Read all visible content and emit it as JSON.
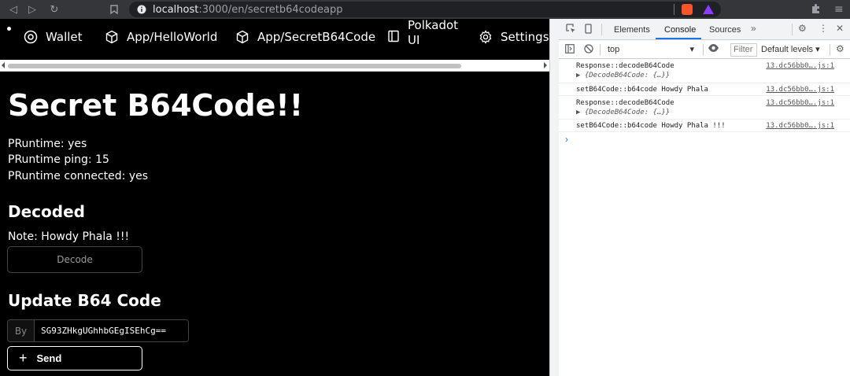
{
  "browser": {
    "url_host": "localhost",
    "url_path": ":3000/en/secretb64codeapp"
  },
  "nav": {
    "items": [
      {
        "label": "Wallet",
        "icon": "circle-dot-icon"
      },
      {
        "label": "App/HelloWorld",
        "icon": "cube-icon"
      },
      {
        "label": "App/SecretB64Code",
        "icon": "cube-icon"
      },
      {
        "label": "Polkadot\nUI",
        "icon": "panel-icon"
      },
      {
        "label": "Settings",
        "icon": "gear-icon"
      }
    ],
    "polkadot_line1": "Polkadot",
    "polkadot_line2": "UI"
  },
  "page": {
    "title": "Secret B64Code!!",
    "status_lines": [
      "PRuntime: yes",
      "PRuntime ping: 15",
      "PRuntime connected: yes"
    ],
    "decoded_heading": "Decoded",
    "note": "Note: Howdy Phala !!!",
    "decode_button": "Decode",
    "update_heading": "Update B64 Code",
    "input_addon": "By",
    "input_value": "SG93ZHkgUGhhbGEgISEhCg==",
    "send_button": "Send"
  },
  "devtools": {
    "tabs": [
      "Elements",
      "Console",
      "Sources"
    ],
    "active_tab": "Console",
    "context": "top",
    "filter_placeholder": "Filter",
    "levels": "Default levels ▾",
    "logs": [
      {
        "text": "Response::decodeB64Code",
        "sub": "▶ {DecodeB64Code: {…}}",
        "src": "13.dc56bb0….js:1"
      },
      {
        "text": "setB64Code::b64code Howdy Phala",
        "sub": "",
        "src": "13.dc56bb0….js:1"
      },
      {
        "text": "Response::decodeB64Code",
        "sub": "▶ {DecodeB64Code: {…}}",
        "src": "13.dc56bb0….js:1"
      },
      {
        "text": "setB64Code::b64code Howdy Phala !!!",
        "sub": "",
        "src": "13.dc56bb0….js:1"
      }
    ]
  }
}
